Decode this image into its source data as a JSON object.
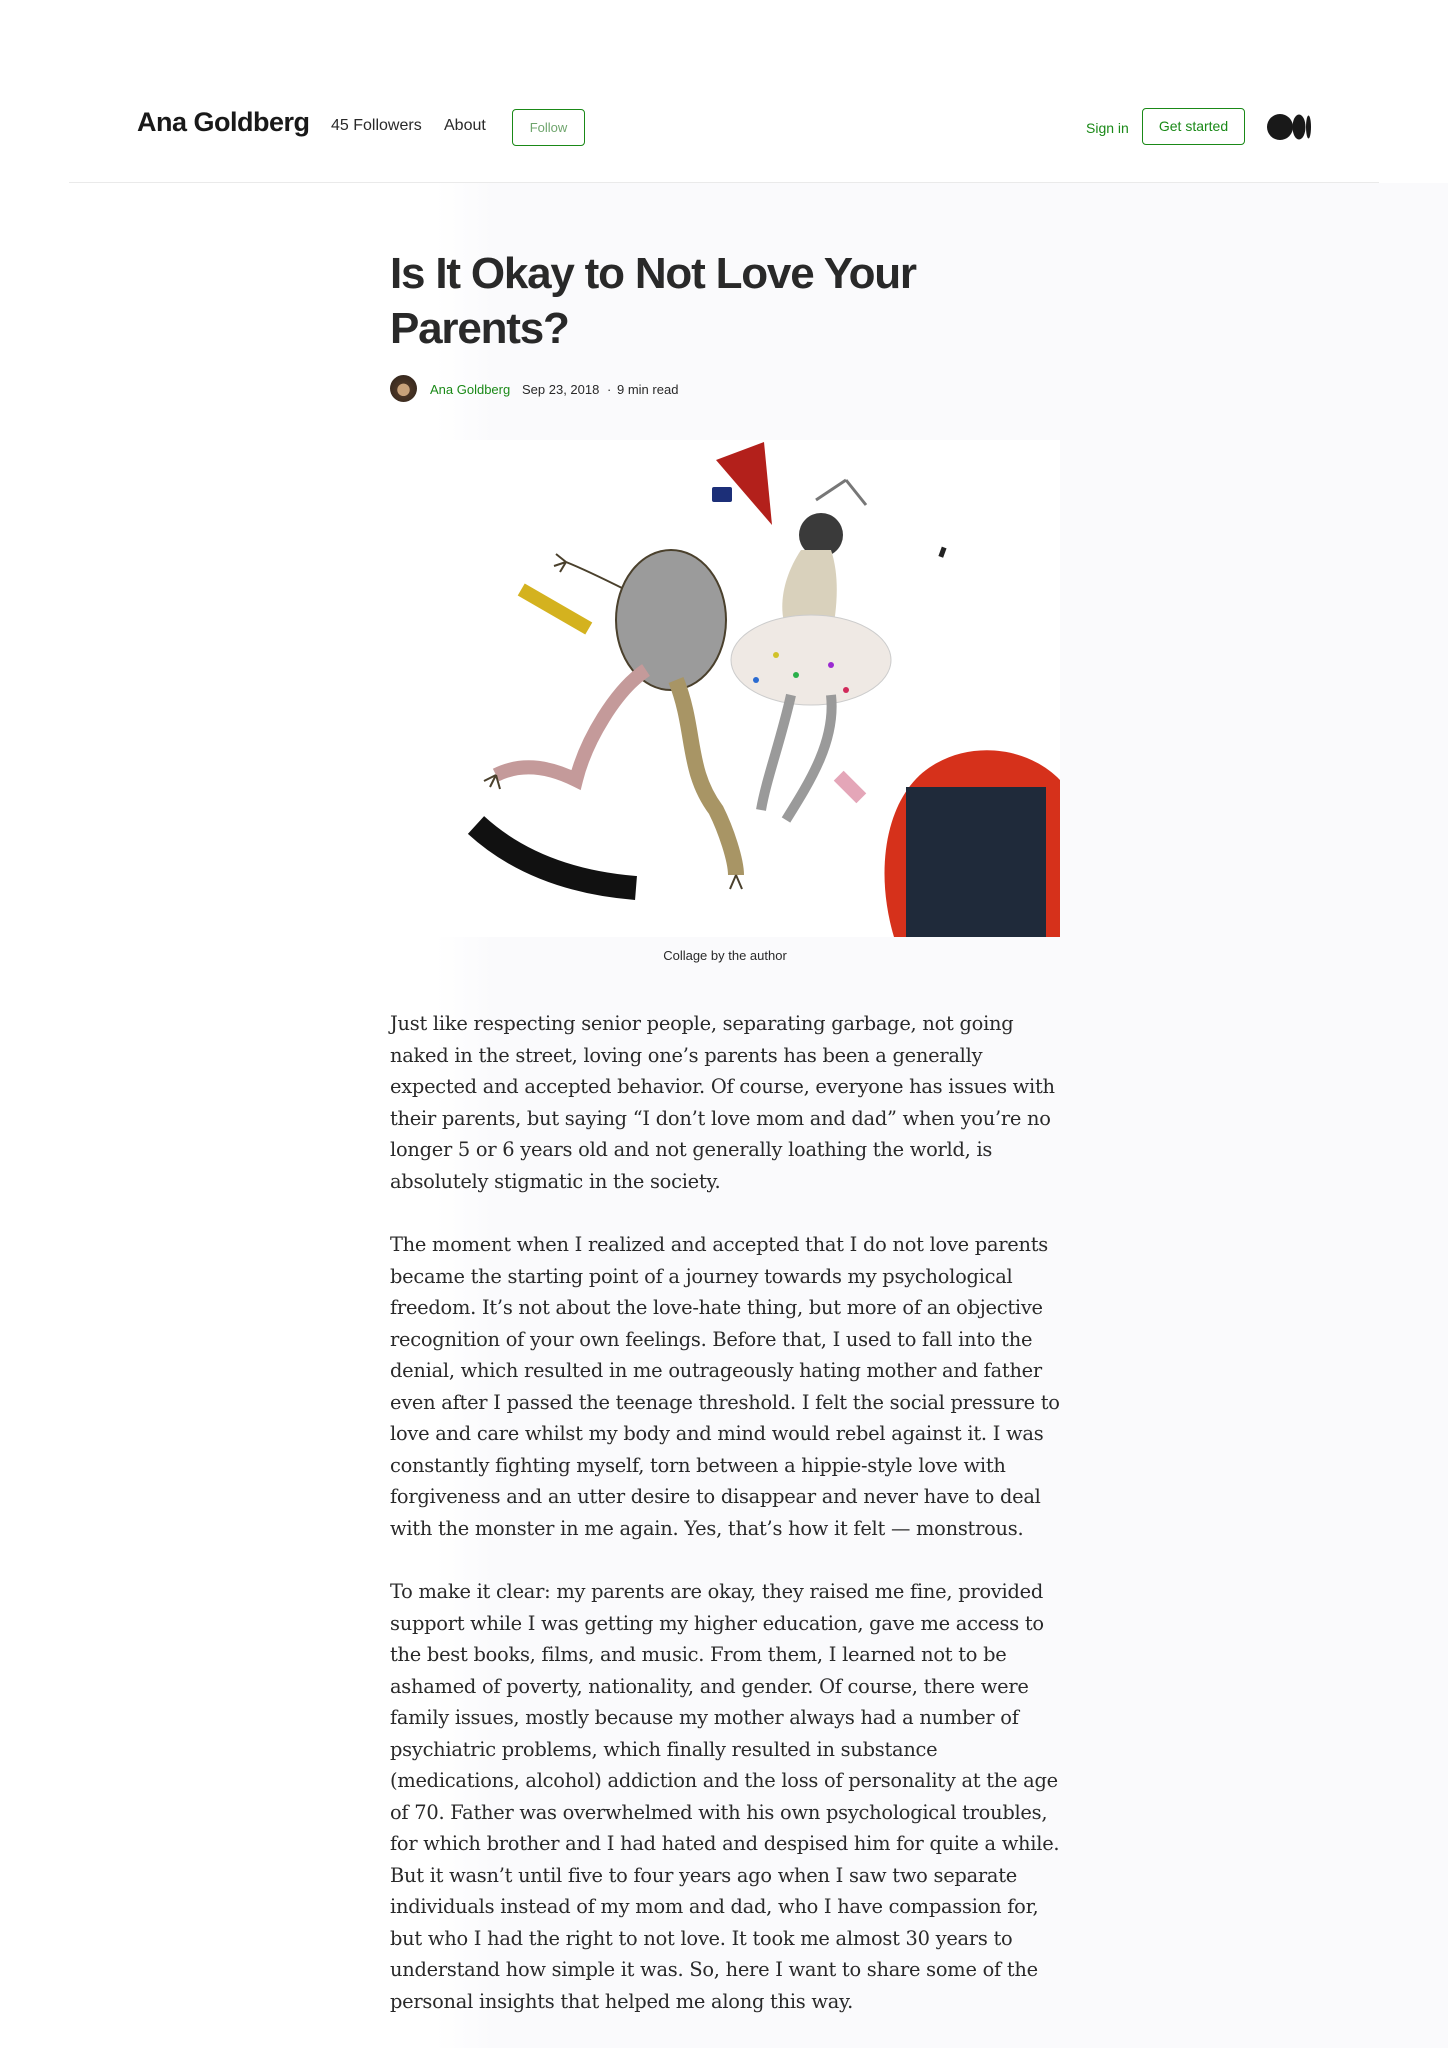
{
  "header": {
    "brand": "Ana Goldberg",
    "followers": "45 Followers",
    "about": "About",
    "follow": "Follow",
    "sign_in": "Sign in",
    "get_started": "Get started",
    "medium_logo_icon": "medium-logo-icon"
  },
  "article": {
    "title": "Is It Okay to Not Love Your Parents?",
    "author": "Ana Goldberg",
    "date": "Sep 23, 2018",
    "separator": "·",
    "read_time": "9 min read",
    "image_caption": "Collage by the author",
    "paragraphs": [
      "Just like respecting senior people, separating garbage, not going naked in the street, loving one’s parents has been a generally expected and accepted behavior. Of course, everyone has issues with their parents, but saying “I don’t love mom and dad” when you’re no longer 5 or 6 years old and not generally loathing the world, is absolutely stigmatic in the society.",
      "The moment when I realized and accepted that I do not love parents became the starting point of a journey towards my psychological freedom. It’s not about the love-hate thing, but more of an objective recognition of your own feelings. Before that, I used to fall into the denial, which resulted in me outrageously hating mother and father even after I passed the teenage threshold. I felt the social pressure to love and care whilst my body and mind would rebel against it. I was constantly fighting myself, torn between a hippie-style love with forgiveness and an utter desire to disappear and never have to deal with the monster in me again. Yes, that’s how it felt — monstrous.",
      "To make it clear: my parents are okay, they raised me fine, provided support while I was getting my higher education, gave me access to the best books, films, and music. From them, I learned not to be ashamed of poverty, nationality, and gender. Of course, there were family issues, mostly because my mother always had a number of psychiatric problems, which finally resulted in substance (medications, alcohol) addiction and the loss of personality at the age of 70. Father was overwhelmed with his own psychological troubles, for which brother and I had hated and despised him for quite a while. But it wasn’t until five to four years ago when I saw two separate individuals instead of my mom and dad, who I have compassion for, but who I had the right to not love. It took me almost 30 years to understand how simple it was. So, here I want to share some of the personal insights that helped me along this way."
    ]
  },
  "colors": {
    "accent_green": "#1a8917",
    "text": "#292929"
  }
}
